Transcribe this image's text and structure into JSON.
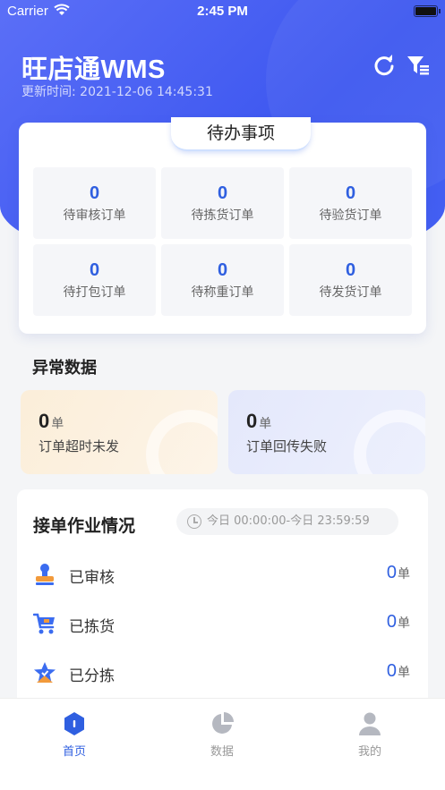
{
  "status_bar": {
    "carrier": "Carrier",
    "time": "2:45 PM"
  },
  "header": {
    "title": "旺店通WMS",
    "update_label": "更新时间:",
    "update_time": "2021-12-06 14:45:31",
    "bg_color": "#3d57f0"
  },
  "todo": {
    "title": "待办事项",
    "items": [
      {
        "count": "0",
        "label": "待审核订单"
      },
      {
        "count": "0",
        "label": "待拣货订单"
      },
      {
        "count": "0",
        "label": "待验货订单"
      },
      {
        "count": "0",
        "label": "待打包订单"
      },
      {
        "count": "0",
        "label": "待称重订单"
      },
      {
        "count": "0",
        "label": "待发货订单"
      }
    ]
  },
  "abnormal": {
    "title": "异常数据",
    "cards": [
      {
        "count": "0",
        "unit": "单",
        "label": "订单超时未发"
      },
      {
        "count": "0",
        "unit": "单",
        "label": "订单回传失败"
      }
    ]
  },
  "work": {
    "title": "接单作业情况",
    "time_range": "今日 00:00:00-今日 23:59:59",
    "rows": [
      {
        "icon": "audit-stamp-icon",
        "label": "已审核",
        "count": "0",
        "unit": "单"
      },
      {
        "icon": "cart-icon",
        "label": "已拣货",
        "count": "0",
        "unit": "单"
      },
      {
        "icon": "star-sort-icon",
        "label": "已分拣",
        "count": "0",
        "unit": "单"
      }
    ]
  },
  "tabbar": {
    "tabs": [
      {
        "label": "首页",
        "icon": "home-icon",
        "active": true
      },
      {
        "label": "数据",
        "icon": "pie-chart-icon",
        "active": false
      },
      {
        "label": "我的",
        "icon": "user-icon",
        "active": false
      }
    ],
    "active_color": "#2f5fe0",
    "inactive_color": "#999999"
  }
}
